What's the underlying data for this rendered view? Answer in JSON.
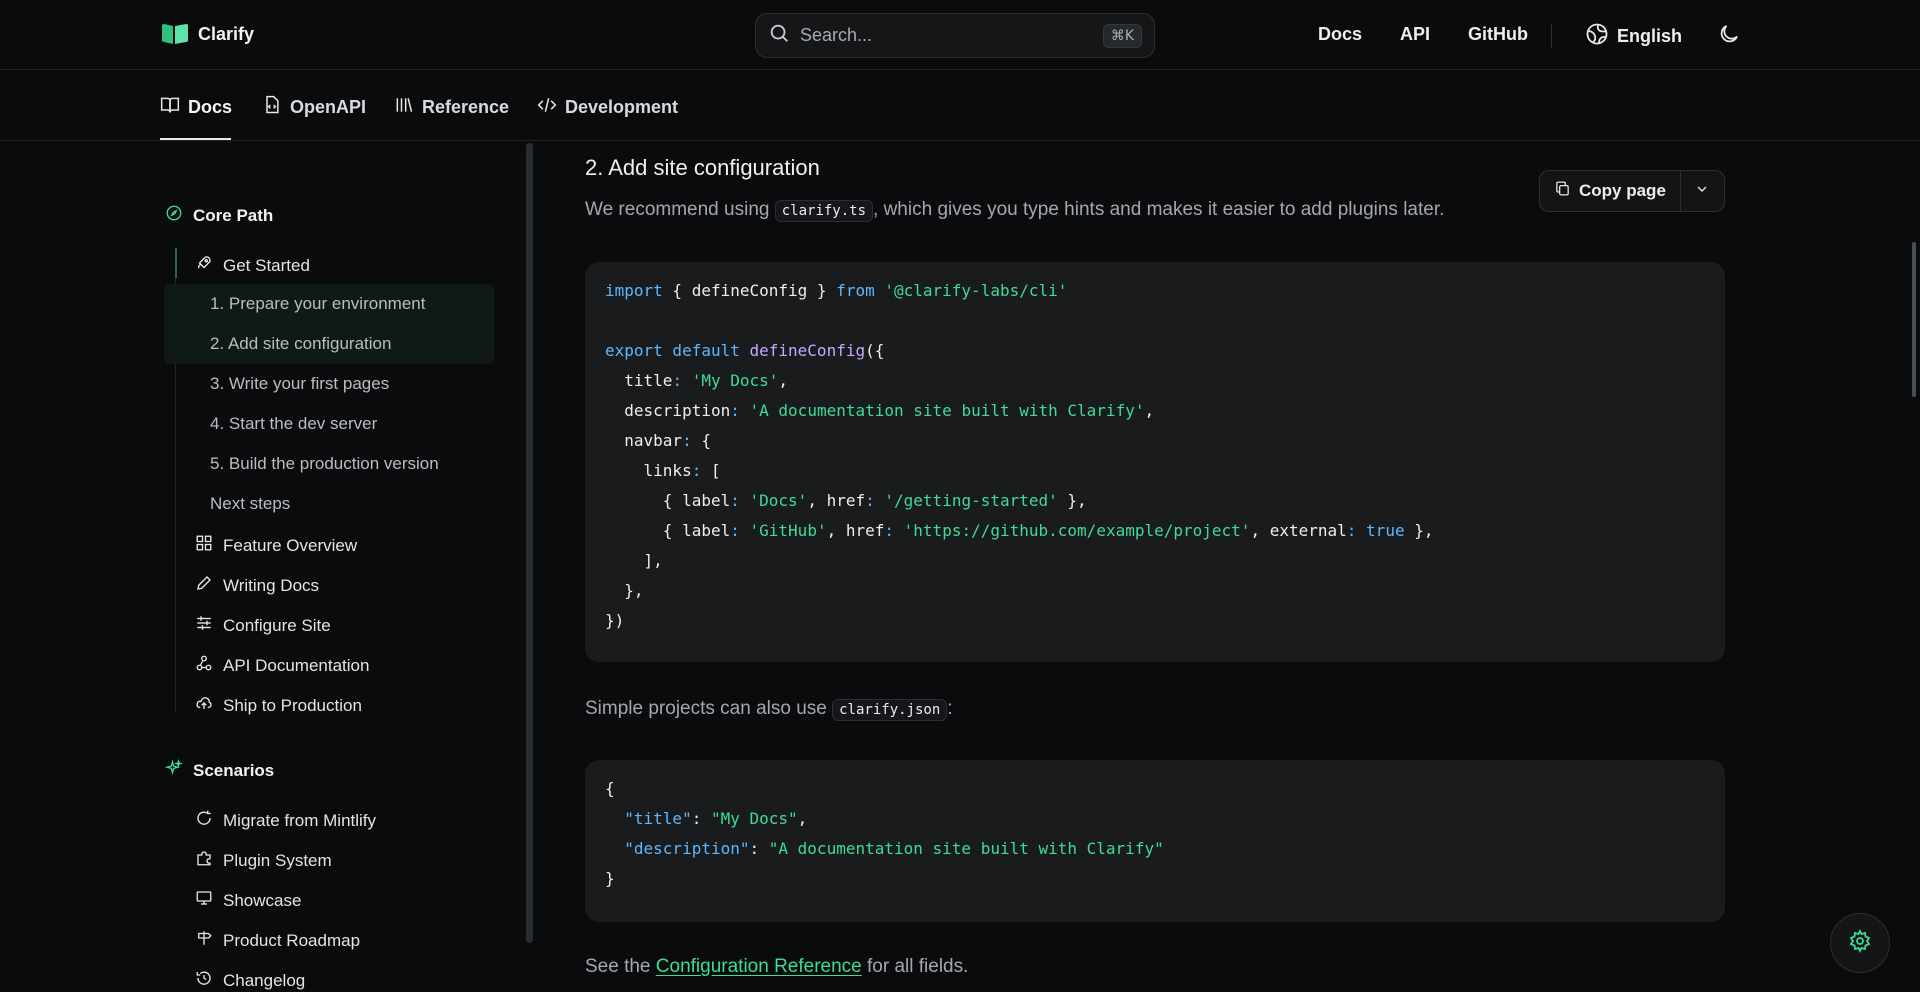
{
  "brand": {
    "name": "Clarify",
    "accent": "#3ddc97"
  },
  "search": {
    "placeholder": "Search...",
    "shortcut": "⌘K"
  },
  "topnav": {
    "docs": "Docs",
    "api": "API",
    "github": "GitHub",
    "language": "English"
  },
  "tabs": [
    {
      "label": "Docs",
      "icon": "book-icon",
      "active": true
    },
    {
      "label": "OpenAPI",
      "icon": "file-code-icon"
    },
    {
      "label": "Reference",
      "icon": "library-icon"
    },
    {
      "label": "Development",
      "icon": "code-icon"
    }
  ],
  "sidebar": {
    "groups": [
      {
        "title": "Core Path",
        "icon": "compass-icon",
        "items": [
          {
            "label": "Get Started",
            "icon": "rocket-icon",
            "active": true,
            "children": [
              "1. Prepare your environment",
              "2. Add site configuration",
              "3. Write your first pages",
              "4. Start the dev server",
              "5. Build the production version",
              "Next steps"
            ]
          },
          {
            "label": "Feature Overview",
            "icon": "grid-icon"
          },
          {
            "label": "Writing Docs",
            "icon": "pen-icon"
          },
          {
            "label": "Configure Site",
            "icon": "sliders-icon"
          },
          {
            "label": "API Documentation",
            "icon": "webhook-icon"
          },
          {
            "label": "Ship to Production",
            "icon": "cloud-upload-icon"
          }
        ]
      },
      {
        "title": "Scenarios",
        "icon": "sparkles-icon",
        "items": [
          {
            "label": "Migrate from Mintlify",
            "icon": "refresh-icon"
          },
          {
            "label": "Plugin System",
            "icon": "puzzle-icon"
          },
          {
            "label": "Showcase",
            "icon": "monitor-icon"
          },
          {
            "label": "Product Roadmap",
            "icon": "signpost-icon"
          },
          {
            "label": "Changelog",
            "icon": "history-icon"
          }
        ]
      }
    ]
  },
  "content": {
    "heading": "2. Add site configuration",
    "copy_label": "Copy page",
    "p1_before": "We recommend using ",
    "p1_code": "clarify.ts",
    "p1_after": ", which gives you type hints and makes it easier to add plugins later.",
    "p2_before": "Simple projects can also use ",
    "p2_code": "clarify.json",
    "p2_after": ":",
    "p3_before": "See the ",
    "p3_link": "Configuration Reference",
    "p3_after": " for all fields.",
    "code_ts": [
      "import { defineConfig } from '@clarify-labs/cli'",
      "",
      "export default defineConfig({",
      "  title: 'My Docs',",
      "  description: 'A documentation site built with Clarify',",
      "  navbar: {",
      "    links: [",
      "      { label: 'Docs', href: '/getting-started' },",
      "      { label: 'GitHub', href: 'https://github.com/example/project', external: true },",
      "    ],",
      "  },",
      "})"
    ],
    "code_json": [
      "{",
      "  \"title\": \"My Docs\",",
      "  \"description\": \"A documentation site built with Clarify\"",
      "}"
    ]
  }
}
